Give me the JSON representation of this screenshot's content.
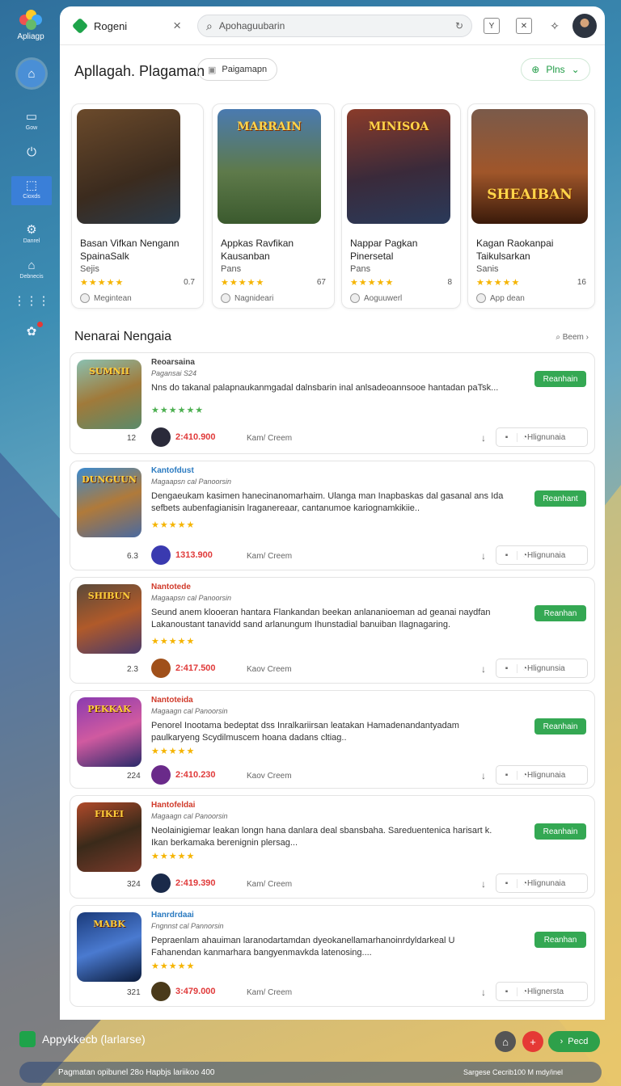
{
  "app": {
    "logo_label": "Apliagp"
  },
  "rail": {
    "items": [
      {
        "label": "Gow",
        "icon": "square-icon"
      },
      {
        "label": "",
        "icon": "power-icon"
      },
      {
        "label": "Cioxds",
        "icon": "cursor-icon"
      },
      {
        "label": "Danrel",
        "icon": "settings-icon"
      },
      {
        "label": "Debnecis",
        "icon": "store-icon"
      },
      {
        "label": "",
        "icon": "grid-icon"
      },
      {
        "label": "",
        "icon": "gear-icon"
      }
    ]
  },
  "tab": {
    "title": "Rogeni"
  },
  "search": {
    "placeholder": "Apohaguubarin"
  },
  "header": {
    "title": "Apllagah. Plagaman",
    "pill_label": "Paigamapn",
    "plus_label": "Plns"
  },
  "featured": [
    {
      "art_text": "",
      "title": "Basan Vifkan Nengann SpainaSalk",
      "sub": "Sejis",
      "rating": "0.7",
      "dev": "Megintean"
    },
    {
      "art_text": "MARRAIN",
      "title": "Appkas Ravfikan Kausanban",
      "sub": "Pans",
      "rating": "67",
      "dev": "Nagnideari"
    },
    {
      "art_text": "MINISOA",
      "title": "Nappar Pagkan Pinersetal",
      "sub": "Pans",
      "rating": "8",
      "dev": "Aoguuwerl"
    },
    {
      "art_text": "SHEAIBAN",
      "title": "Kagan Raokanpai Taikulsarkan",
      "sub": "Sanis",
      "rating": "16",
      "dev": "App dean"
    }
  ],
  "list": {
    "title": "Nenarai Nengaia",
    "see_more": "Beem",
    "rows": [
      {
        "art_text": "SUMNII",
        "name": "Reoarsaina",
        "sub": "Pagansai S24",
        "desc": "Nns do takanal palapnaukanmgadal dalnsbarin inal anlsadeoannsooe hantadan paTsk...",
        "count": "12",
        "price": "2:410.900",
        "by": "Kam/ Creem",
        "action": "Hlignunaia",
        "get": "Reanhain"
      },
      {
        "art_text": "DUNGUUN",
        "name": "Kantofdust",
        "sub": "Magaapsn cal Panoorsin",
        "desc": "Dengaeukam kasimen hanecinanomarhaim. Ulanga man Inapbaskas dal gasanal ans Ida sefbets aubenfagianisin lraganereaar, cantanumoe kariognamkikiie..",
        "count": "6.3",
        "price": "1313.900",
        "by": "Kam/ Creem",
        "action": "Hlignunaia",
        "get": "Reanhant"
      },
      {
        "art_text": "SHIBUN",
        "name": "Nantotede",
        "sub": "Magaapsn cal Panoorsin",
        "desc": "Seund anem klooeran hantara Flankandan beekan anlananioeman ad geanai naydfan Lakanoustant tanavidd sand arlanungum Ihunstadial banuiban Ilagnagaring.",
        "count": "2.3",
        "price": "2:417.500",
        "by": "Kaov Creem",
        "action": "Hlignunsia",
        "get": "Reanhan"
      },
      {
        "art_text": "PEKKAK",
        "name": "Nantoteida",
        "sub": "Magaagn cal Panoorsin",
        "desc": "Penorel Inootama bedeptat dss Inralkariirsan leatakan Hamadenandantyadam paulkaryeng Scydilmuscem hoana dadans cltiag..",
        "count": "224",
        "price": "2:410.230",
        "by": "Kaov Creem",
        "action": "Hlignunaia",
        "get": "Reanhain"
      },
      {
        "art_text": "FIKEI",
        "name": "Hantofeldai",
        "sub": "Magaagn cal Panoorsin",
        "desc": "Neolainigiemar leakan longn hana danlara deal sbansbaha. Sareduentenica harisart k. Ikan berkamaka berenignin plersag...",
        "count": "324",
        "price": "2:419.390",
        "by": "Kam/ Creem",
        "action": "Hlignunaia",
        "get": "Reanhain"
      },
      {
        "art_text": "MABK",
        "name": "Hanrdrdaai",
        "sub": "Fngnnst cal Pannorsin",
        "desc": "Pepraenlam ahauiman laranodartamdan dyeokanellamarhanoinrdyldarkeal U Fahanendan kanmarhara bangyenmavkda latenosing....",
        "count": "321",
        "price": "3:479.000",
        "by": "Kam/ Creem",
        "action": "Hlignersta",
        "get": "Reanhan"
      }
    ]
  },
  "bottom": {
    "app_label": "Appykkecb (larlarse)",
    "next_label": "Pecd",
    "status_left": "Pagmatan opibunel 28o Hapbjs lariikoo 400",
    "status_right": "Sargese Cecrib100 M mdy/inel"
  },
  "colors": {
    "accent": "#34a853",
    "price": "#e03a3a",
    "stars": "#f5b400"
  }
}
